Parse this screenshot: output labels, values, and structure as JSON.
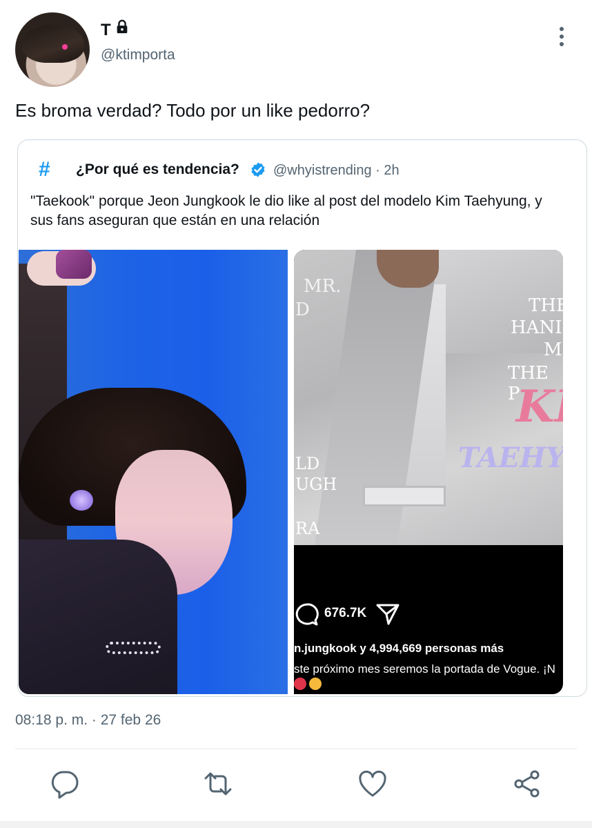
{
  "tweet": {
    "display_name": "T",
    "handle": "@ktimporta",
    "text": "Es broma verdad? Todo por un like pedorro?",
    "timestamp": "08:18 p. m. · 27 feb 26"
  },
  "quote": {
    "name": "¿Por qué es tendencia?",
    "handle_time": "@whyistrending · 2h",
    "text": "\"Taekook\" porque Jeon Jungkook le dio like al post del modelo Kim Taehyung, y sus fans aseguran que están en una relación"
  },
  "media_right": {
    "magazine_lines": [
      "MR.",
      "D",
      "THE",
      "HANI",
      "M",
      "THE P",
      "KI",
      "TAEHY",
      "LD",
      "UGH",
      "RA"
    ],
    "comment_count": "676.7K",
    "likes_text": "n.jungkook y 4,994,669 personas más",
    "caption": "ste próximo mes seremos la portada de Vogue. ¡N"
  },
  "icons": {
    "lock": "lock-icon",
    "more": "more-vertical-icon",
    "verified": "verified-badge-icon",
    "reply": "reply-icon",
    "retweet": "retweet-icon",
    "like": "heart-icon",
    "share": "share-icon"
  },
  "colors": {
    "accent": "#1d9bf0",
    "secondary_text": "#536471",
    "border": "#cfd9de"
  }
}
